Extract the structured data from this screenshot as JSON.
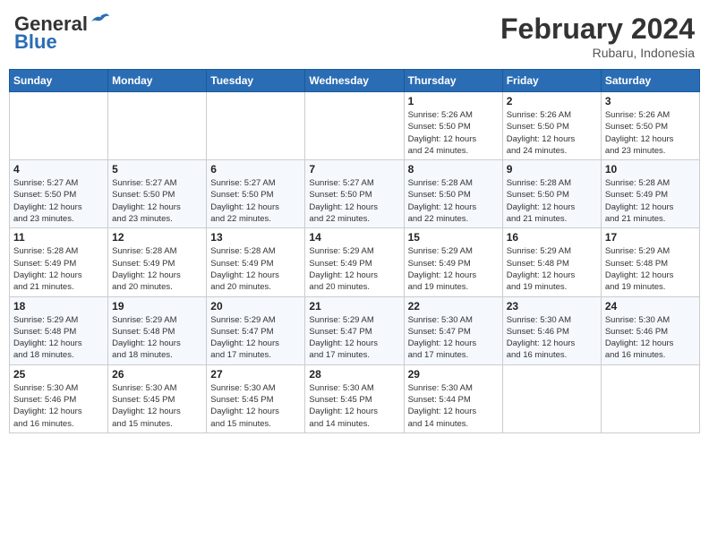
{
  "header": {
    "logo_general": "General",
    "logo_blue": "Blue",
    "month_year": "February 2024",
    "location": "Rubaru, Indonesia"
  },
  "days_of_week": [
    "Sunday",
    "Monday",
    "Tuesday",
    "Wednesday",
    "Thursday",
    "Friday",
    "Saturday"
  ],
  "weeks": [
    [
      {
        "day": "",
        "detail": ""
      },
      {
        "day": "",
        "detail": ""
      },
      {
        "day": "",
        "detail": ""
      },
      {
        "day": "",
        "detail": ""
      },
      {
        "day": "1",
        "detail": "Sunrise: 5:26 AM\nSunset: 5:50 PM\nDaylight: 12 hours\nand 24 minutes."
      },
      {
        "day": "2",
        "detail": "Sunrise: 5:26 AM\nSunset: 5:50 PM\nDaylight: 12 hours\nand 24 minutes."
      },
      {
        "day": "3",
        "detail": "Sunrise: 5:26 AM\nSunset: 5:50 PM\nDaylight: 12 hours\nand 23 minutes."
      }
    ],
    [
      {
        "day": "4",
        "detail": "Sunrise: 5:27 AM\nSunset: 5:50 PM\nDaylight: 12 hours\nand 23 minutes."
      },
      {
        "day": "5",
        "detail": "Sunrise: 5:27 AM\nSunset: 5:50 PM\nDaylight: 12 hours\nand 23 minutes."
      },
      {
        "day": "6",
        "detail": "Sunrise: 5:27 AM\nSunset: 5:50 PM\nDaylight: 12 hours\nand 22 minutes."
      },
      {
        "day": "7",
        "detail": "Sunrise: 5:27 AM\nSunset: 5:50 PM\nDaylight: 12 hours\nand 22 minutes."
      },
      {
        "day": "8",
        "detail": "Sunrise: 5:28 AM\nSunset: 5:50 PM\nDaylight: 12 hours\nand 22 minutes."
      },
      {
        "day": "9",
        "detail": "Sunrise: 5:28 AM\nSunset: 5:50 PM\nDaylight: 12 hours\nand 21 minutes."
      },
      {
        "day": "10",
        "detail": "Sunrise: 5:28 AM\nSunset: 5:49 PM\nDaylight: 12 hours\nand 21 minutes."
      }
    ],
    [
      {
        "day": "11",
        "detail": "Sunrise: 5:28 AM\nSunset: 5:49 PM\nDaylight: 12 hours\nand 21 minutes."
      },
      {
        "day": "12",
        "detail": "Sunrise: 5:28 AM\nSunset: 5:49 PM\nDaylight: 12 hours\nand 20 minutes."
      },
      {
        "day": "13",
        "detail": "Sunrise: 5:28 AM\nSunset: 5:49 PM\nDaylight: 12 hours\nand 20 minutes."
      },
      {
        "day": "14",
        "detail": "Sunrise: 5:29 AM\nSunset: 5:49 PM\nDaylight: 12 hours\nand 20 minutes."
      },
      {
        "day": "15",
        "detail": "Sunrise: 5:29 AM\nSunset: 5:49 PM\nDaylight: 12 hours\nand 19 minutes."
      },
      {
        "day": "16",
        "detail": "Sunrise: 5:29 AM\nSunset: 5:48 PM\nDaylight: 12 hours\nand 19 minutes."
      },
      {
        "day": "17",
        "detail": "Sunrise: 5:29 AM\nSunset: 5:48 PM\nDaylight: 12 hours\nand 19 minutes."
      }
    ],
    [
      {
        "day": "18",
        "detail": "Sunrise: 5:29 AM\nSunset: 5:48 PM\nDaylight: 12 hours\nand 18 minutes."
      },
      {
        "day": "19",
        "detail": "Sunrise: 5:29 AM\nSunset: 5:48 PM\nDaylight: 12 hours\nand 18 minutes."
      },
      {
        "day": "20",
        "detail": "Sunrise: 5:29 AM\nSunset: 5:47 PM\nDaylight: 12 hours\nand 17 minutes."
      },
      {
        "day": "21",
        "detail": "Sunrise: 5:29 AM\nSunset: 5:47 PM\nDaylight: 12 hours\nand 17 minutes."
      },
      {
        "day": "22",
        "detail": "Sunrise: 5:30 AM\nSunset: 5:47 PM\nDaylight: 12 hours\nand 17 minutes."
      },
      {
        "day": "23",
        "detail": "Sunrise: 5:30 AM\nSunset: 5:46 PM\nDaylight: 12 hours\nand 16 minutes."
      },
      {
        "day": "24",
        "detail": "Sunrise: 5:30 AM\nSunset: 5:46 PM\nDaylight: 12 hours\nand 16 minutes."
      }
    ],
    [
      {
        "day": "25",
        "detail": "Sunrise: 5:30 AM\nSunset: 5:46 PM\nDaylight: 12 hours\nand 16 minutes."
      },
      {
        "day": "26",
        "detail": "Sunrise: 5:30 AM\nSunset: 5:45 PM\nDaylight: 12 hours\nand 15 minutes."
      },
      {
        "day": "27",
        "detail": "Sunrise: 5:30 AM\nSunset: 5:45 PM\nDaylight: 12 hours\nand 15 minutes."
      },
      {
        "day": "28",
        "detail": "Sunrise: 5:30 AM\nSunset: 5:45 PM\nDaylight: 12 hours\nand 14 minutes."
      },
      {
        "day": "29",
        "detail": "Sunrise: 5:30 AM\nSunset: 5:44 PM\nDaylight: 12 hours\nand 14 minutes."
      },
      {
        "day": "",
        "detail": ""
      },
      {
        "day": "",
        "detail": ""
      }
    ]
  ]
}
